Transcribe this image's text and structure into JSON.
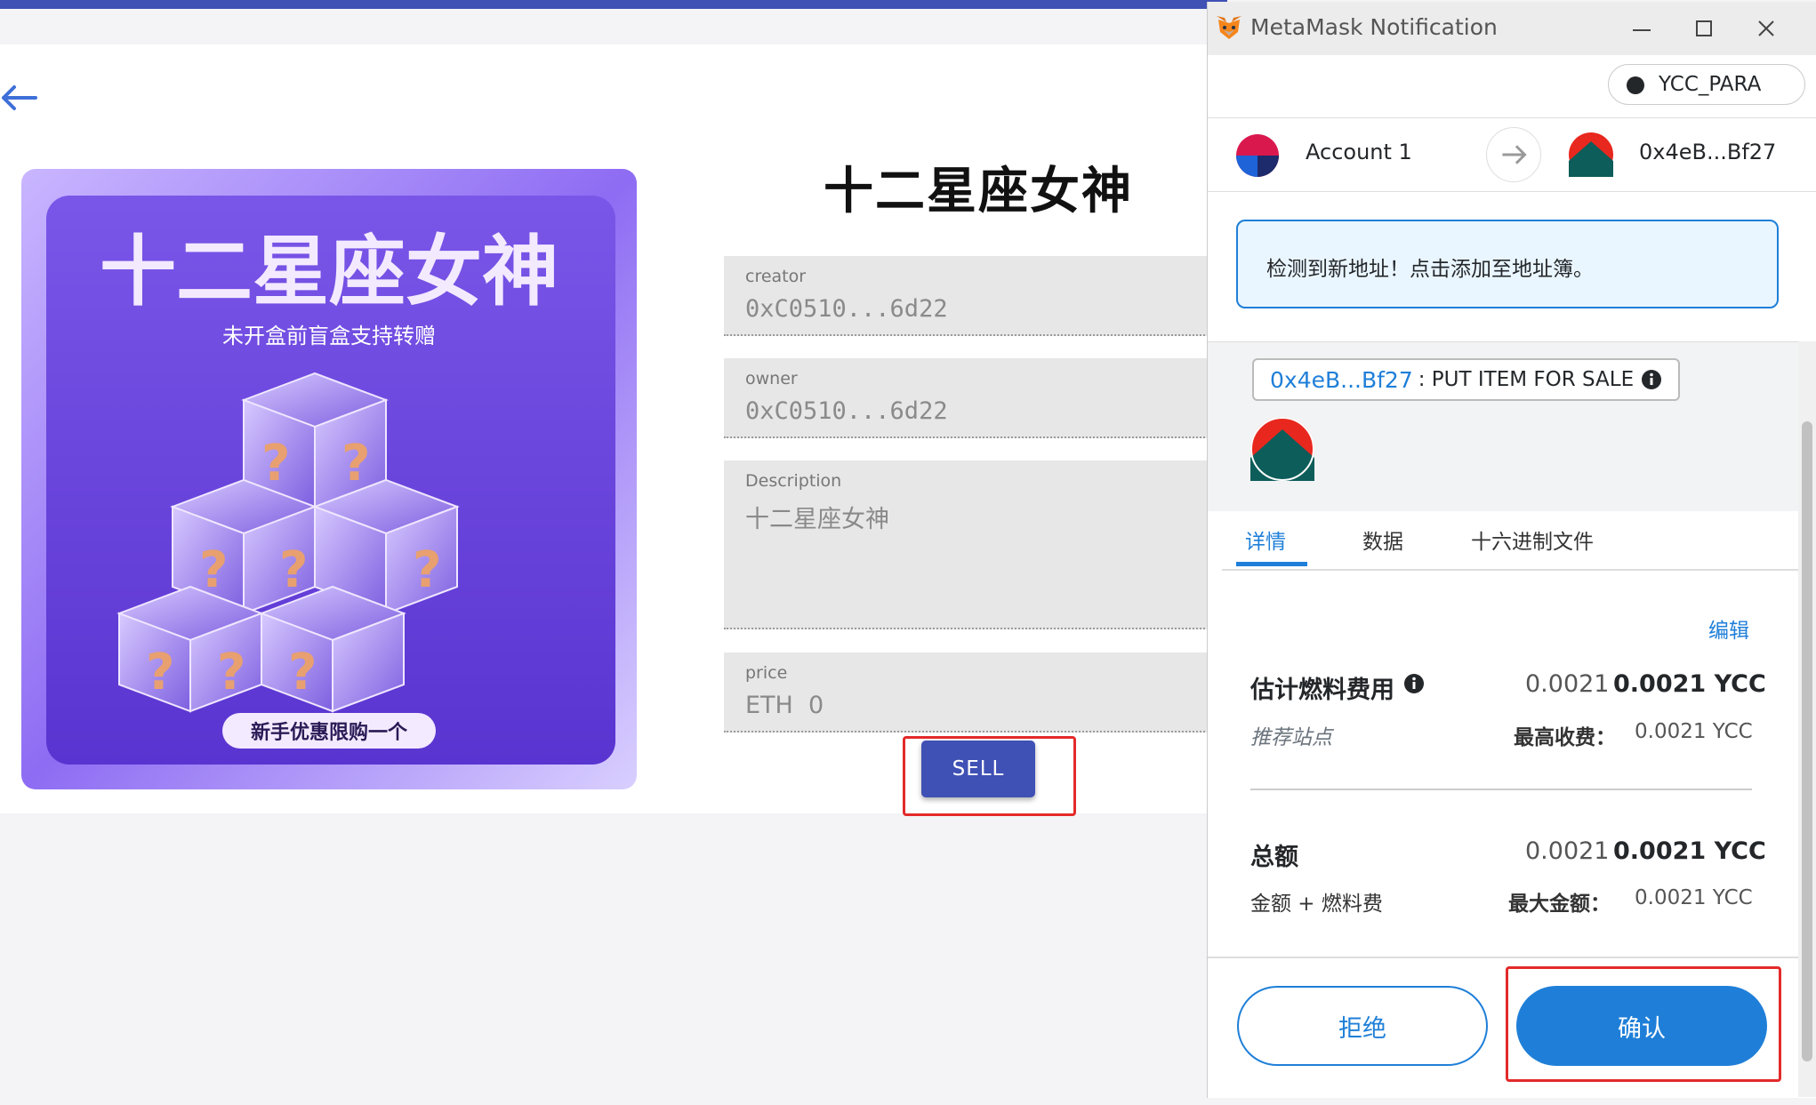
{
  "page": {
    "nft_title": "十二星座女神",
    "image": {
      "headline": "十二星座女神",
      "subtitle": "未开盒前盲盒支持转赠",
      "promo": "新手优惠限购一个"
    },
    "fields": [
      {
        "label": "creator",
        "value": "0xC0510...6d22"
      },
      {
        "label": "owner",
        "value": "0xC0510...6d22"
      },
      {
        "label": "Description",
        "value": "十二星座女神"
      },
      {
        "label": "price",
        "value": "ETH  0"
      }
    ],
    "sell_label": "SELL",
    "highlight_color": "#e32a2a",
    "accent_color": "#3f51b5"
  },
  "metamask": {
    "window_title": "MetaMask Notification",
    "network": "YCC_PARA",
    "from_account": "Account 1",
    "to_address": "0x4eB...Bf27",
    "alert": "检测到新地址！点击添加至地址簿。",
    "method_address": "0x4eB...Bf27",
    "method_name": ": PUT ITEM FOR SALE",
    "tabs": [
      "详情",
      "数据",
      "十六进制文件"
    ],
    "edit": "编辑",
    "gas": {
      "label": "估计燃料费用",
      "amount": "0.0021",
      "amount_bold": "0.0021 YCC",
      "site_label": "推荐站点",
      "max_label": "最高收费：",
      "max_value": "0.0021 YCC"
    },
    "total": {
      "label": "总额",
      "amount": "0.0021",
      "amount_bold": "0.0021 YCC",
      "sub_label": "金额 + 燃料费",
      "max_label": "最大金额：",
      "max_value": "0.0021 YCC"
    },
    "reject": "拒绝",
    "confirm": "确认",
    "brand_blue": "#1f7fd8"
  }
}
